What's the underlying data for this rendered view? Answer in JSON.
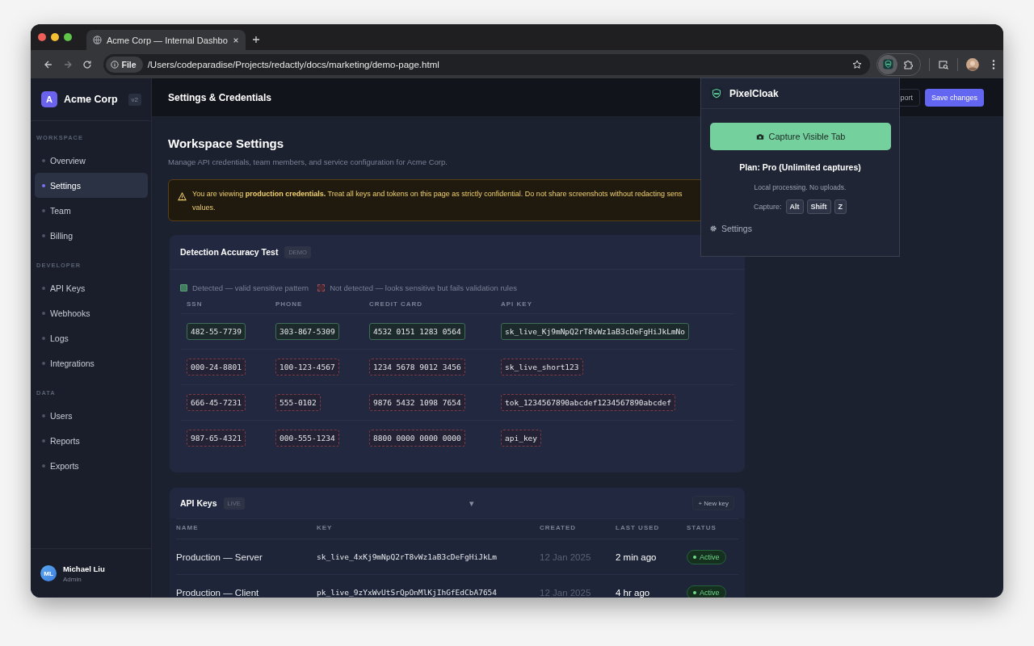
{
  "browser": {
    "tabs": [
      {
        "title": "Acme Corp — Internal Dashbo",
        "selected": true
      }
    ],
    "address": {
      "scheme": "File",
      "url": "/Users/codeparadise/Projects/redactly/docs/marketing/demo-page.html"
    }
  },
  "sidebar": {
    "brand": {
      "initial": "A",
      "name": "Acme Corp",
      "version": "v2"
    },
    "sections": [
      {
        "title": "WORKSPACE",
        "items": [
          {
            "label": "Overview",
            "selected": false
          },
          {
            "label": "Settings",
            "selected": true
          },
          {
            "label": "Team",
            "selected": false
          },
          {
            "label": "Billing",
            "selected": false
          }
        ]
      },
      {
        "title": "DEVELOPER",
        "items": [
          {
            "label": "API Keys",
            "selected": false
          },
          {
            "label": "Webhooks",
            "selected": false
          },
          {
            "label": "Logs",
            "selected": false
          },
          {
            "label": "Integrations",
            "selected": false
          }
        ]
      },
      {
        "title": "DATA",
        "items": [
          {
            "label": "Users",
            "selected": false
          },
          {
            "label": "Reports",
            "selected": false
          },
          {
            "label": "Exports",
            "selected": false
          }
        ]
      }
    ],
    "user": {
      "initials": "ML",
      "name": "Michael Liu",
      "role": "Admin"
    }
  },
  "header": {
    "title": "Settings & Credentials",
    "buttons": [
      {
        "label": "port",
        "kind": "secondary"
      },
      {
        "label": "Save changes",
        "kind": "primary"
      }
    ]
  },
  "page": {
    "title": "Workspace Settings",
    "subtitle": "Manage API credentials, team members, and service configuration for Acme Corp.",
    "alert": {
      "lines": [
        "You are viewing **production credentials.** Treat all keys and tokens on this page as strictly confidential. Do not share screenshots without redacting sens",
        "values."
      ]
    }
  },
  "detection": {
    "title": "Detection Accuracy Test",
    "badge": "DEMO",
    "legend": [
      {
        "label": "Detected — valid sensitive pattern",
        "detected": true
      },
      {
        "label": "Not detected — looks sensitive but fails validation rules",
        "detected": false
      }
    ],
    "columns": [
      "SSN",
      "PHONE",
      "CREDIT CARD",
      "API KEY"
    ],
    "rows": [
      {
        "cells": [
          {
            "value": "482-55-7739",
            "detected": true
          },
          {
            "value": "303-867-5309",
            "detected": true
          },
          {
            "value": "4532 0151 1283 0564",
            "detected": true
          },
          {
            "value": "sk_live_Kj9mNpQ2rT8vWz1aB3cDeFgHiJkLmNo",
            "detected": true
          }
        ]
      },
      {
        "cells": [
          {
            "value": "000-24-8801",
            "detected": false
          },
          {
            "value": "100-123-4567",
            "detected": false
          },
          {
            "value": "1234 5678 9012 3456",
            "detected": false
          },
          {
            "value": "sk_live_short123",
            "detected": false
          }
        ]
      },
      {
        "cells": [
          {
            "value": "666-45-7231",
            "detected": false
          },
          {
            "value": "555-0102",
            "detected": false
          },
          {
            "value": "9876 5432 1098 7654",
            "detected": false
          },
          {
            "value": "tok_1234567890abcdef1234567890abcdef",
            "detected": false
          }
        ]
      },
      {
        "cells": [
          {
            "value": "987-65-4321",
            "detected": false
          },
          {
            "value": "000-555-1234",
            "detected": false
          },
          {
            "value": "8800 0000 0000 0000",
            "detected": false
          },
          {
            "value": "api_key",
            "detected": false
          }
        ]
      }
    ]
  },
  "api_keys": {
    "title": "API Keys",
    "badge": "LIVE",
    "toggle": "▾",
    "new_button": "+ New key",
    "columns": [
      "NAME",
      "KEY",
      "CREATED",
      "LAST USED",
      "STATUS"
    ],
    "rows": [
      {
        "name": "Production — Server",
        "key": "sk_live_4xKj9mNpQ2rT8vWz1aB3cDeFgHiJkLm",
        "created": "12 Jan 2025",
        "last_used": "2 min ago",
        "status": "Active"
      },
      {
        "name": "Production — Client",
        "key": "pk_live_9zYxWvUtSrQpOnMlKjIhGfEdCbA7654",
        "created": "12 Jan 2025",
        "last_used": "4 hr ago",
        "status": "Active"
      }
    ]
  },
  "popup": {
    "title": "PixelCloak",
    "capture_button": "Capture Visible Tab",
    "plan": "Plan: Pro (Unlimited captures)",
    "note": "Local processing. No uploads.",
    "shortcut": {
      "label": "Capture:",
      "keys": [
        "Alt",
        "Shift",
        "Z"
      ]
    },
    "settings": "Settings"
  }
}
